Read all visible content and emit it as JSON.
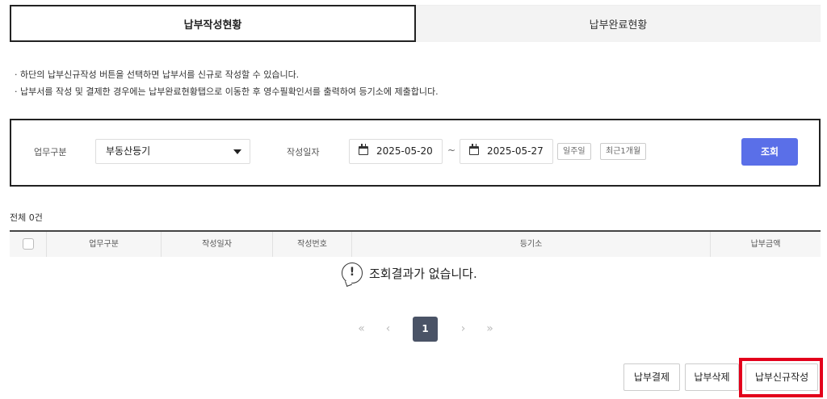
{
  "tabs": [
    {
      "label": "납부작성현황",
      "active": true
    },
    {
      "label": "납부완료현황",
      "active": false
    }
  ],
  "notices": [
    "· 하단의 납부신규작성 버튼을 선택하면 납부서를 신규로 작성할 수 있습니다.",
    "· 납부서를 작성 및 결제한 경우에는 납부완료현황탭으로 이동한 후 영수필확인서를 출력하여 등기소에 제출합니다."
  ],
  "search": {
    "work_type_label": "업무구분",
    "work_type_value": "부동산등기",
    "date_label": "작성일자",
    "date_from": "2025-05-20",
    "date_sep": "~",
    "date_to": "2025-05-27",
    "quick_week": "일주일",
    "quick_month": "최근1개월",
    "search_button": "조회",
    "accent_color": "#5a6fe8"
  },
  "table": {
    "total_text": "전체 0건",
    "columns": [
      "업무구분",
      "작성일자",
      "작성번호",
      "등기소",
      "납부금액"
    ],
    "rows": [],
    "empty_message": "조회결과가 없습니다.",
    "empty_icon": "exclamation-bubble-icon"
  },
  "pagination": {
    "first": "«",
    "prev": "‹",
    "current_page": "1",
    "next": "›",
    "last": "»"
  },
  "actions": {
    "pay": "납부결제",
    "delete": "납부삭제",
    "new": "납부신규작성",
    "highlight_color": "#e3001b"
  }
}
